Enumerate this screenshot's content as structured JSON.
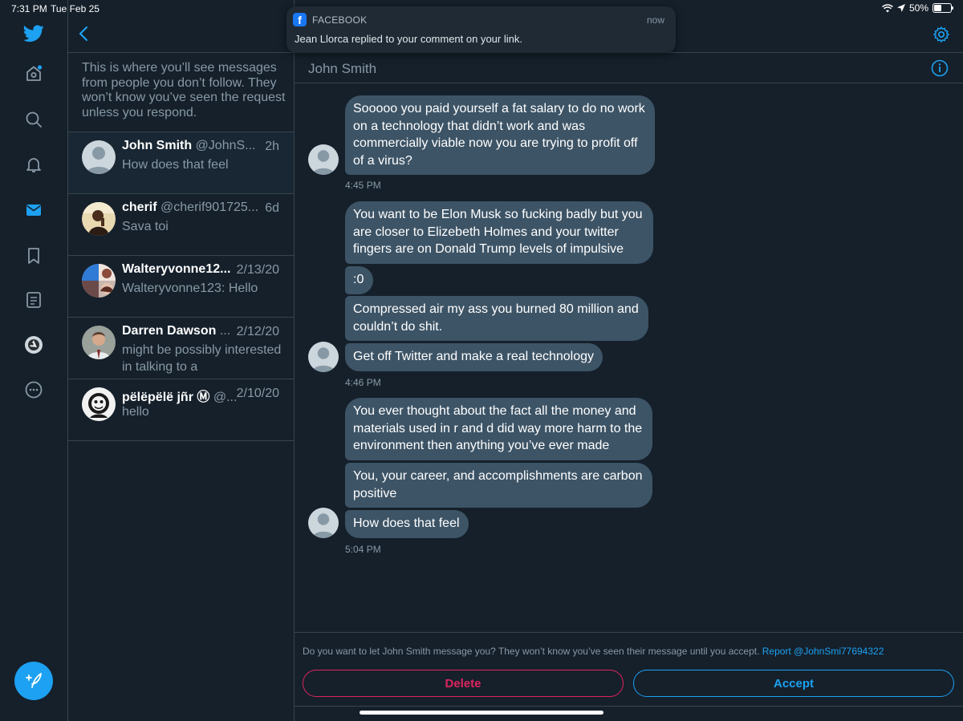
{
  "status_bar": {
    "time": "7:31 PM",
    "date": "Tue Feb 25",
    "battery": "50%",
    "battery_level": 0.5
  },
  "colors": {
    "background": "#15202b",
    "accent": "#1da1f2",
    "danger": "#e0245e",
    "bubble": "#3d5466",
    "muted": "#8899a6"
  },
  "nav": {
    "icons": [
      "twitter-bird-icon",
      "home-icon",
      "search-icon",
      "bell-icon",
      "mail-icon",
      "bookmark-icon",
      "list-icon",
      "profile-avatar",
      "more-icon"
    ],
    "active": "mail-icon",
    "compose_icon": "compose-tweet-icon"
  },
  "requests": {
    "intro": "This is where you’ll see messages from people you don’t follow. They won’t know you’ve seen the request unless you respond.",
    "items": [
      {
        "name": "John Smith",
        "handle": "@JohnS...",
        "time": "2h",
        "preview": "How does that feel",
        "selected": true
      },
      {
        "name": "cherif",
        "handle": "@cherif901725...",
        "time": "6d",
        "preview": "Sava toi"
      },
      {
        "name": "Walteryvonne12...",
        "handle": "",
        "time": "2/13/20",
        "preview": "Walteryvonne123: Hello"
      },
      {
        "name": "Darren Dawson",
        "handle": "...",
        "time": "2/12/20",
        "preview": "might be possibly interested in talking to a"
      },
      {
        "name": "pëlëpëlë jñr Ⓜ",
        "handle": "@...",
        "time": "2/10/20",
        "preview": "hello"
      }
    ]
  },
  "conversation": {
    "title": "John Smith",
    "messages": [
      "Sooooo you paid yourself a fat salary to do no work on a technology that didn’t work and was commercially viable now you are trying to profit off of a virus?",
      "You want to be Elon Musk so fucking badly but you are closer to Elizebeth Holmes and your twitter fingers are on Donald Trump levels of impulsive",
      ":0",
      "Compressed air my ass you burned 80 million and couldn’t do shit.",
      "Get off Twitter and make a real technology",
      "You ever thought about the fact all the money and materials used in r and d did way more harm to the environment then anything you’ve ever made",
      "You, your career, and accomplishments are carbon positive",
      "How does that feel"
    ],
    "timestamps": [
      "4:45 PM",
      "4:46 PM",
      "5:04 PM"
    ]
  },
  "request_bar": {
    "notice": "Do you want to let John Smith message you? They won’t know you’ve seen their message until you accept.",
    "report_link": "Report @JohnSmi77694322",
    "delete_label": "Delete",
    "accept_label": "Accept"
  },
  "notification": {
    "app": "FACEBOOK",
    "time": "now",
    "body": "Jean Llorca replied to your comment on your link."
  }
}
